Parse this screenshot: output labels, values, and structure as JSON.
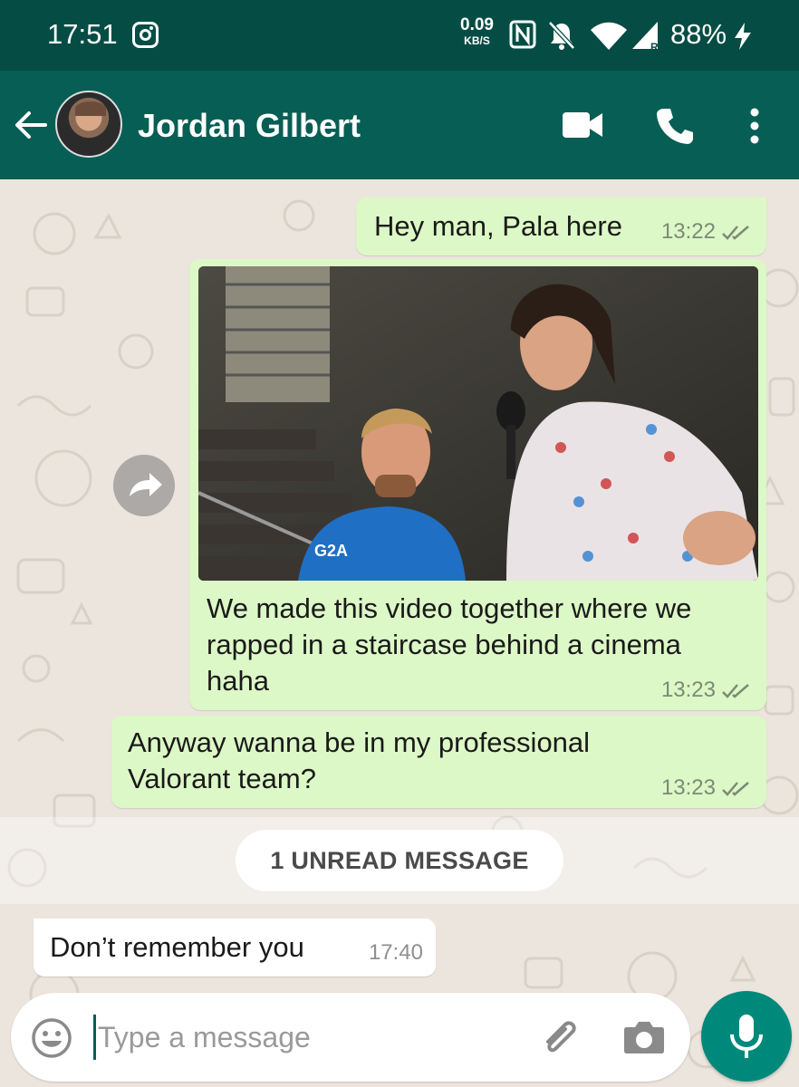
{
  "status_bar": {
    "time": "17:51",
    "net_speed_value": "0.09",
    "net_speed_unit": "KB/S",
    "battery": "88%",
    "icons": [
      "instagram-icon",
      "nfc-icon",
      "mute-bell-icon",
      "wifi-icon",
      "signal-icon",
      "charging-icon"
    ]
  },
  "header": {
    "contact_name": "Jordan Gilbert",
    "icons": [
      "back-arrow-icon",
      "video-call-icon",
      "phone-call-icon",
      "more-vert-icon"
    ]
  },
  "messages": [
    {
      "direction": "out",
      "text": "Hey man, Pala here",
      "time": "13:22",
      "status": "read"
    },
    {
      "direction": "out",
      "type": "image",
      "text": "We made this video together where we rapped in a staircase behind a cinema haha",
      "time": "13:23",
      "status": "read"
    },
    {
      "direction": "out",
      "text": "Anyway wanna be in my professional Valorant team?",
      "time": "13:23",
      "status": "read"
    },
    {
      "direction": "in",
      "text": "Don’t remember you",
      "time": "17:40"
    }
  ],
  "unread_banner": "1 UNREAD MESSAGE",
  "composer": {
    "placeholder": "Type a message",
    "icons": [
      "emoji-icon",
      "attach-icon",
      "camera-icon",
      "mic-icon"
    ]
  },
  "colors": {
    "status_bar": "#054d44",
    "app_bar": "#075e54",
    "outgoing_bubble": "#dcf8c6",
    "incoming_bubble": "#ffffff",
    "mic_button": "#00897b",
    "chat_background": "#ece5dd"
  }
}
